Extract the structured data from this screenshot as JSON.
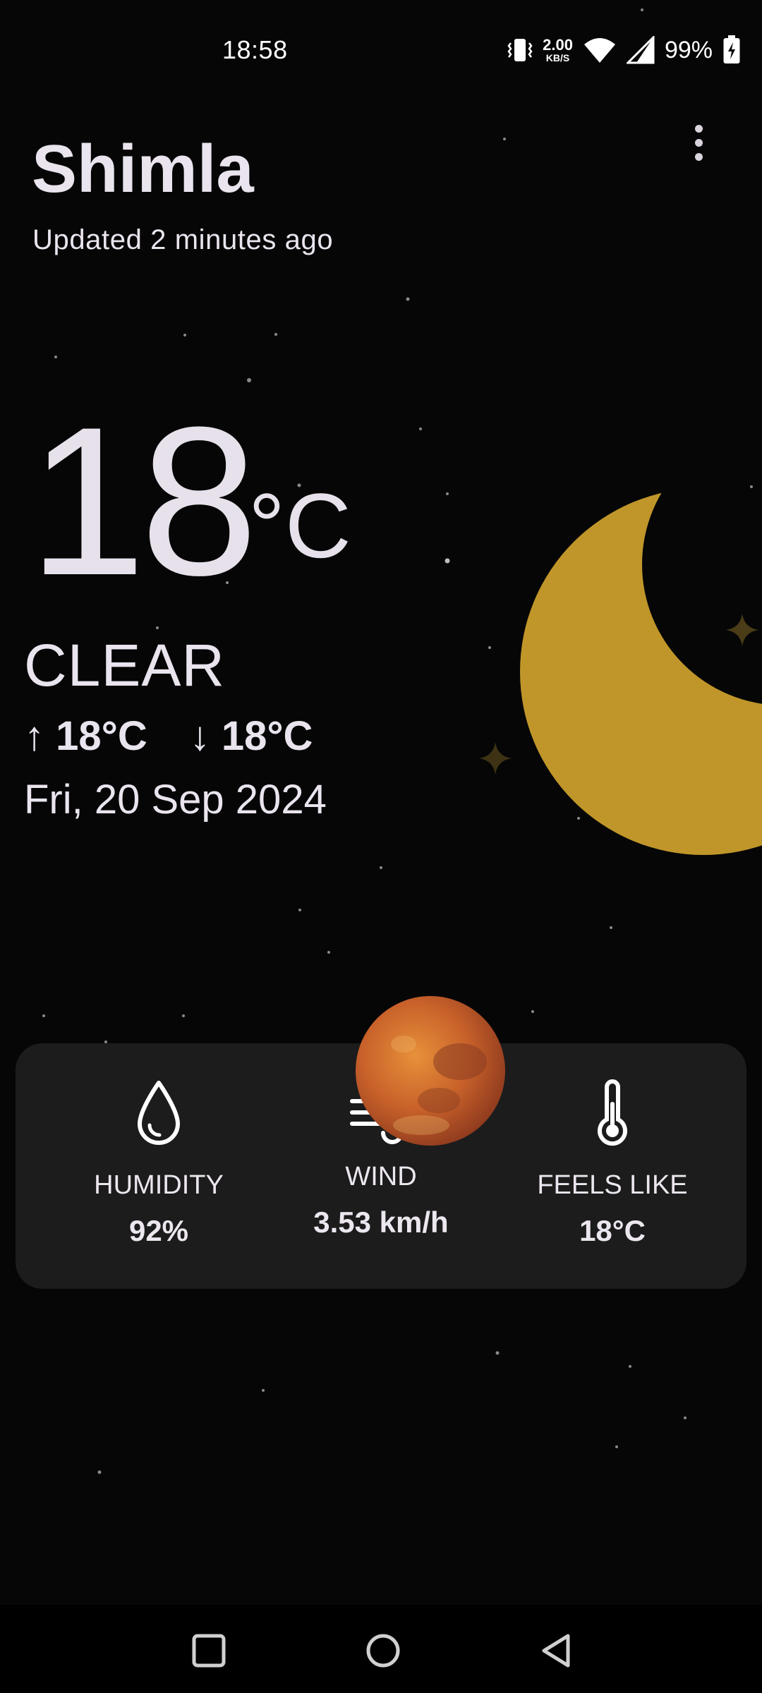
{
  "status_bar": {
    "time": "18:58",
    "net_speed_value": "2.00",
    "net_speed_unit": "KB/S",
    "battery": "99%",
    "icons": [
      "vibrate-icon",
      "wifi-icon",
      "signal-icon",
      "battery-charging-icon"
    ]
  },
  "header": {
    "city": "Shimla",
    "updated": "Updated 2 minutes ago",
    "menu_icon": "more-vert-icon"
  },
  "current": {
    "temperature": "18",
    "unit": "°C",
    "condition": "CLEAR",
    "high": "↑ 18°C",
    "low": "↓ 18°C",
    "date": "Fri, 20 Sep 2024"
  },
  "illustration": {
    "moon_color": "#c0962a",
    "sparkle_color": "#4a3c16"
  },
  "stats": [
    {
      "icon": "water-drop-icon",
      "label": "HUMIDITY",
      "value": "92%"
    },
    {
      "icon": "wind-icon",
      "label": "WIND",
      "value": "3.53 km/h"
    },
    {
      "icon": "thermometer-icon",
      "label": "FEELS LIKE",
      "value": "18°C"
    }
  ],
  "nav": {
    "icons": [
      "recents-square-icon",
      "home-circle-icon",
      "back-triangle-icon"
    ]
  }
}
